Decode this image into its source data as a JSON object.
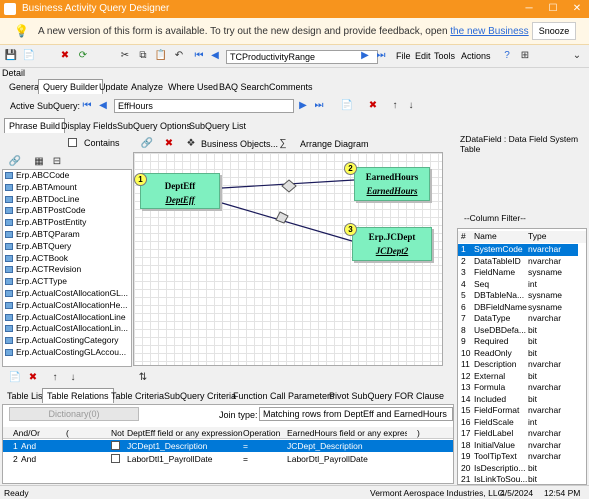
{
  "window": {
    "title": "Business Activity Query Designer"
  },
  "notice": {
    "text": "A new version of this form is available. To try out the new design and provide feedback, open ",
    "link": "the new Business",
    "snooze": "Snooze"
  },
  "toolbar": {
    "query_id": "TCProductivityRange",
    "menus": [
      "File",
      "Edit",
      "Tools",
      "Actions"
    ]
  },
  "detail_label": "Detail",
  "main_tabs": [
    "General",
    "Query Builder",
    "Update",
    "Analyze",
    "Where Used",
    "BAQ Search",
    "Comments"
  ],
  "subquery": {
    "label": "Active SubQuery:",
    "value": "EffHours"
  },
  "sub_tabs": [
    "Phrase Build",
    "Display Fields",
    "SubQuery Options",
    "SubQuery List"
  ],
  "contains_label": "Contains",
  "diagram_toolbar": {
    "business_objects": "Business Objects...",
    "arrange": "Arrange Diagram"
  },
  "tables": [
    "Erp.ABCCode",
    "Erp.ABTAmount",
    "Erp.ABTDocLine",
    "Erp.ABTPostCode",
    "Erp.ABTPostEntity",
    "Erp.ABTQParam",
    "Erp.ABTQuery",
    "Erp.ACTBook",
    "Erp.ACTRevision",
    "Erp.ACTType",
    "Erp.ActualCostAllocationGL...",
    "Erp.ActualCostAllocationHe...",
    "Erp.ActualCostAllocationLine",
    "Erp.ActualCostAllocationLin...",
    "Erp.ActualCostingCategory",
    "Erp.ActualCostingGLAccou..."
  ],
  "diagram": {
    "nodes": [
      {
        "num": "1",
        "name": "DeptEff",
        "alias": "DeptEff"
      },
      {
        "num": "2",
        "name": "EarnedHours",
        "alias": "EarnedHours"
      },
      {
        "num": "3",
        "name": "Erp.JCDept",
        "alias": "JCDept2"
      }
    ]
  },
  "field_info": "ZDataField : Data Field System Table",
  "column_filter": "--Column Filter--",
  "columns_header": {
    "num": "#",
    "name": "Name",
    "type": "Type"
  },
  "columns": [
    {
      "num": "1",
      "name": "SystemCode",
      "type": "nvarchar"
    },
    {
      "num": "2",
      "name": "DataTableID",
      "type": "nvarchar"
    },
    {
      "num": "3",
      "name": "FieldName",
      "type": "sysname"
    },
    {
      "num": "4",
      "name": "Seq",
      "type": "int"
    },
    {
      "num": "5",
      "name": "DBTableNa...",
      "type": "sysname"
    },
    {
      "num": "6",
      "name": "DBFieldName",
      "type": "sysname"
    },
    {
      "num": "7",
      "name": "DataType",
      "type": "nvarchar"
    },
    {
      "num": "8",
      "name": "UseDBDefa...",
      "type": "bit"
    },
    {
      "num": "9",
      "name": "Required",
      "type": "bit"
    },
    {
      "num": "10",
      "name": "ReadOnly",
      "type": "bit"
    },
    {
      "num": "11",
      "name": "Description",
      "type": "nvarchar"
    },
    {
      "num": "12",
      "name": "External",
      "type": "bit"
    },
    {
      "num": "13",
      "name": "Formula",
      "type": "nvarchar"
    },
    {
      "num": "14",
      "name": "Included",
      "type": "bit"
    },
    {
      "num": "15",
      "name": "FieldFormat",
      "type": "nvarchar"
    },
    {
      "num": "16",
      "name": "FieldScale",
      "type": "int"
    },
    {
      "num": "17",
      "name": "FieldLabel",
      "type": "nvarchar"
    },
    {
      "num": "18",
      "name": "InitialValue",
      "type": "nvarchar"
    },
    {
      "num": "19",
      "name": "ToolTipText",
      "type": "nvarchar"
    },
    {
      "num": "20",
      "name": "IsDescriptio...",
      "type": "bit"
    },
    {
      "num": "21",
      "name": "IsLinkToSou...",
      "type": "bit"
    }
  ],
  "bottom_tabs": [
    "Table List",
    "Table Relations",
    "Table Criteria",
    "SubQuery Criteria",
    "Function Call Parameters",
    "Pivot SubQuery FOR Clause"
  ],
  "relations": {
    "dictionary_btn": "Dictionary(0)",
    "join_label": "Join type:",
    "join_value": "Matching rows from DeptEff and EarnedHours",
    "headers": [
      "And/Or",
      "(",
      "Not",
      "DeptEff field or any expression",
      "Operation",
      "EarnedHours field or any expressio",
      ")"
    ],
    "rows": [
      {
        "num": "1",
        "andor": "And",
        "left": "JCDept1_Description",
        "op": "=",
        "right": "JCDept_Description"
      },
      {
        "num": "2",
        "andor": "And",
        "left": "LaborDtl1_PayrollDate",
        "op": "=",
        "right": "LaborDtl_PayrollDate"
      }
    ]
  },
  "status": {
    "left": "Ready",
    "company": "Vermont Aerospace Industries, LLC.",
    "date": "4/5/2024",
    "time": "12:54 PM"
  },
  "colors": {
    "accent": "#f7941d",
    "node": "#7ff0c0",
    "selection": "#0078d7"
  }
}
